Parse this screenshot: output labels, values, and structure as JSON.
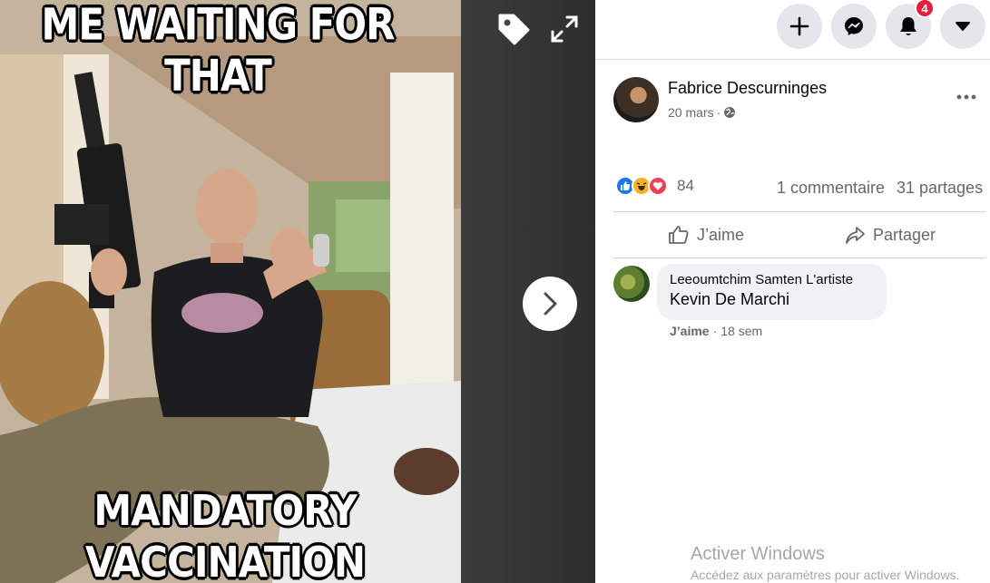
{
  "viewer": {
    "meme_top_text": "ME WAITING FOR THAT",
    "meme_bottom_line1": "MANDATORY",
    "meme_bottom_line2": "VACCINATION",
    "icons": [
      "tag-icon",
      "expand-icon",
      "chevron-right-icon"
    ]
  },
  "topbar": {
    "buttons": [
      "plus-icon",
      "messenger-icon",
      "bell-icon",
      "caret-down-icon"
    ],
    "notification_count": "4"
  },
  "post": {
    "author": "Fabrice Descurninges",
    "date": "20 mars",
    "date_separator": "·",
    "privacy_icon": "globe-icon",
    "reaction_count": "84",
    "comments_label": "1 commentaire",
    "shares_label": "31 partages",
    "like_action": "J’aime",
    "share_action": "Partager"
  },
  "comment": {
    "author": "Leeoumtchim Samten L'artiste",
    "text": "Kevin De Marchi",
    "like_label": "J’aime",
    "meta_separator": "·",
    "time": "18 sem"
  },
  "os_overlay": {
    "title": "Activer Windows",
    "subtitle": "Accédez aux paramètres pour activer Windows."
  },
  "colors": {
    "accent": "#1877f2",
    "notification": "#e41e3f",
    "secondary_text": "#65676b",
    "button_bg": "#e4e6eb"
  }
}
